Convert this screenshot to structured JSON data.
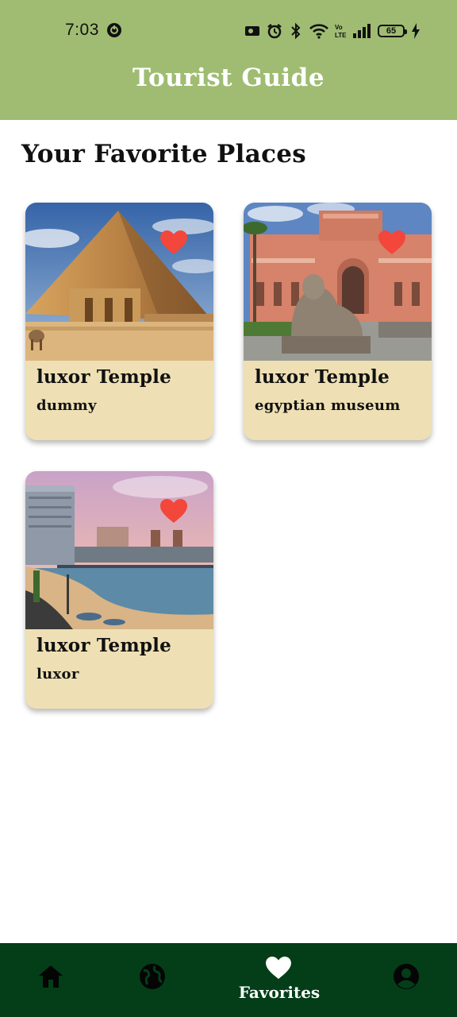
{
  "status": {
    "time": "7:03",
    "battery": "65"
  },
  "app": {
    "title": "Tourist Guide"
  },
  "page": {
    "title": "Your Favorite Places"
  },
  "cards": [
    {
      "title": "luxor Temple",
      "subtitle": "dummy",
      "image": "pyramid-photo",
      "favorite": true
    },
    {
      "title": "luxor Temple",
      "subtitle": "egyptian museum",
      "image": "egyptian-museum-photo",
      "favorite": true
    },
    {
      "title": "luxor Temple",
      "subtitle": "luxor",
      "image": "seaside-city-photo",
      "favorite": true
    }
  ],
  "nav": {
    "items": [
      {
        "icon": "home-icon",
        "label": ""
      },
      {
        "icon": "globe-icon",
        "label": ""
      },
      {
        "icon": "heart-icon",
        "label": "Favorites",
        "active": true
      },
      {
        "icon": "account-icon",
        "label": ""
      }
    ]
  },
  "colors": {
    "app_bar": "#9fbc72",
    "card_bg": "#eee0b4",
    "bottom_nav": "#033e18",
    "heart": "#f2473a"
  }
}
